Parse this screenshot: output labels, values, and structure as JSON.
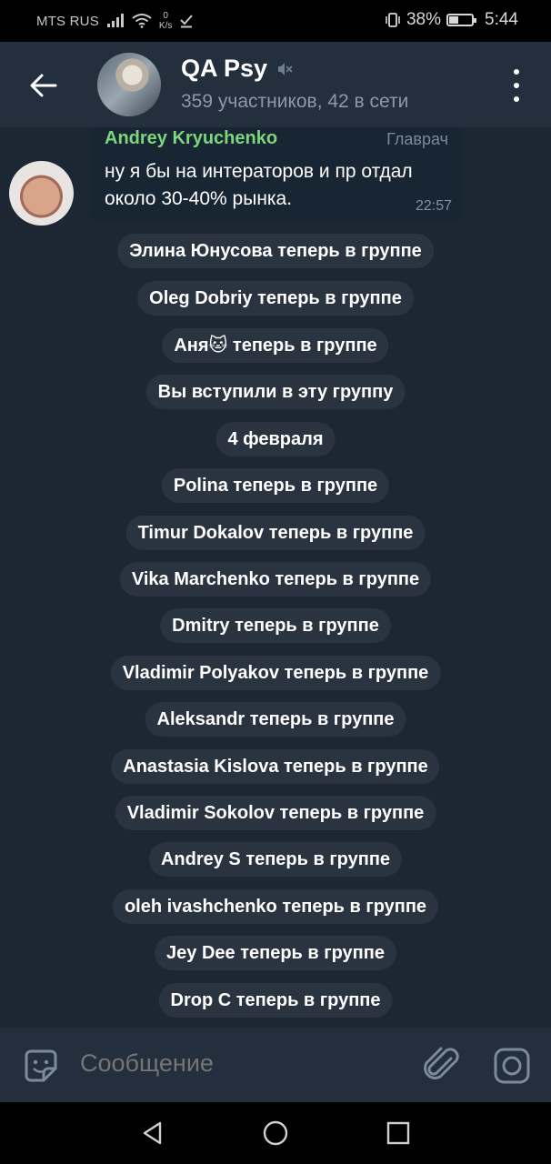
{
  "status_bar": {
    "carrier": "MTS RUS",
    "net_speed_value": "0",
    "net_speed_unit": "K/s",
    "battery_percent": "38%",
    "battery_level": 0.38,
    "time": "5:44"
  },
  "header": {
    "title": "QA Psy",
    "subtitle": "359 участников, 42 в сети",
    "muted": true
  },
  "message": {
    "author": "Andrey Kryuchenko",
    "author_color": "#7dd67e",
    "role": "Главрач",
    "text": "ну я бы на интераторов и пр отдал около 30-40% рынка.",
    "time": "22:57"
  },
  "service_messages": [
    "Элина Юнусова теперь в группе",
    "Oleg Dobriy теперь в группе",
    "Аня🐱 теперь в группе",
    "Вы вступили в эту группу",
    "4 февраля",
    "Polina теперь в группе",
    "Timur Dokalov теперь в группе",
    "Vika Marchenko теперь в группе",
    "Dmitry теперь в группе",
    "Vladimir Polyakov теперь в группе",
    "Aleksandr теперь в группе",
    "Anastasia Kislova теперь в группе",
    "Vladimir Sokolov теперь в группе",
    "Andrey S теперь в группе",
    "oleh ivashchenko теперь в группе",
    "Jey Dee теперь в группе",
    "Drop C теперь в группе"
  ],
  "input": {
    "placeholder": "Сообщение"
  },
  "colors": {
    "background": "#1d2733",
    "header": "#242f3d",
    "bubble": "#182533",
    "service_pill": "#2a3441"
  }
}
